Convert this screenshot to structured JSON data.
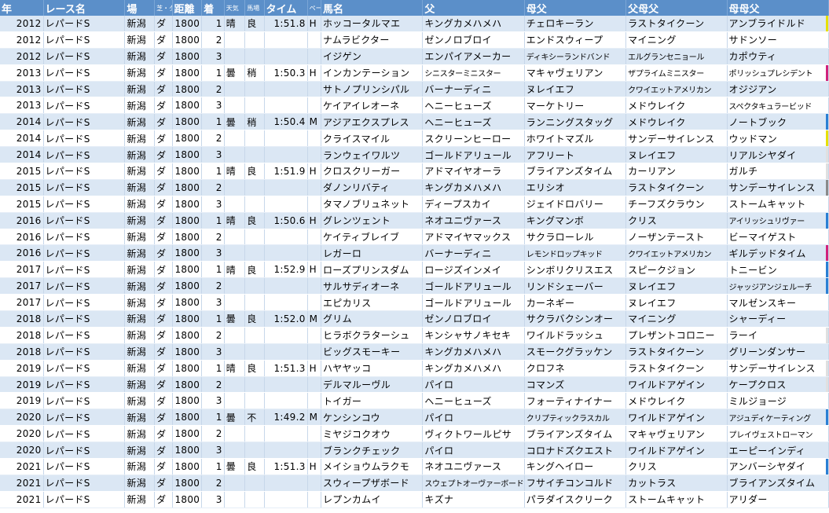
{
  "headers": [
    "年",
    "レース名",
    "場",
    "芝・ダ",
    "距離",
    "着",
    "天気",
    "馬場",
    "タイム",
    "ペース",
    "馬名",
    "父",
    "母父",
    "父母父",
    "母母父"
  ],
  "rows": [
    [
      "2012",
      "レパードS",
      "新潟",
      "ダ",
      "1800",
      "1",
      "晴",
      "良",
      "1:51.8",
      "H",
      "ホッコータルマエ",
      "キングカメハメハ",
      "チェロキーラン",
      "ラストタイクーン",
      "アンブライドルド"
    ],
    [
      "2012",
      "レパードS",
      "新潟",
      "ダ",
      "1800",
      "2",
      "",
      "",
      "",
      "",
      "ナムラビクター",
      "ゼンノロブロイ",
      "エンドスウィープ",
      "マイニング",
      "サドンソー"
    ],
    [
      "2012",
      "レパードS",
      "新潟",
      "ダ",
      "1800",
      "3",
      "",
      "",
      "",
      "",
      "イジゲン",
      "エンパイアメーカー",
      "ディキシーランドバンド",
      "エルグランセニョール",
      "カポウティ"
    ],
    [
      "2013",
      "レパードS",
      "新潟",
      "ダ",
      "1800",
      "1",
      "曇",
      "稍",
      "1:50.3",
      "H",
      "インカンテーション",
      "シニスターミニスター",
      "マキャヴェリアン",
      "ザプライムミニスター",
      "ポリッシュプレシデント"
    ],
    [
      "2013",
      "レパードS",
      "新潟",
      "ダ",
      "1800",
      "2",
      "",
      "",
      "",
      "",
      "サトノプリンシパル",
      "バーナーディニ",
      "ヌレイエフ",
      "クワイエットアメリカン",
      "オジジアン"
    ],
    [
      "2013",
      "レパードS",
      "新潟",
      "ダ",
      "1800",
      "3",
      "",
      "",
      "",
      "",
      "ケイアイレオーネ",
      "ヘニーヒューズ",
      "マーケトリー",
      "メドウレイク",
      "スペクタキュラービッド"
    ],
    [
      "2014",
      "レパードS",
      "新潟",
      "ダ",
      "1800",
      "1",
      "曇",
      "稍",
      "1:50.4",
      "M",
      "アジアエクスプレス",
      "ヘニーヒューズ",
      "ランニングスタッグ",
      "メドウレイク",
      "ノートブック"
    ],
    [
      "2014",
      "レパードS",
      "新潟",
      "ダ",
      "1800",
      "2",
      "",
      "",
      "",
      "",
      "クライスマイル",
      "スクリーンヒーロー",
      "ホワイトマズル",
      "サンデーサイレンス",
      "ウッドマン"
    ],
    [
      "2014",
      "レパードS",
      "新潟",
      "ダ",
      "1800",
      "3",
      "",
      "",
      "",
      "",
      "ランウェイワルツ",
      "ゴールドアリュール",
      "アフリート",
      "ヌレイエフ",
      "リアルシヤダイ"
    ],
    [
      "2015",
      "レパードS",
      "新潟",
      "ダ",
      "1800",
      "1",
      "晴",
      "良",
      "1:51.9",
      "H",
      "クロスクリーガー",
      "アドマイヤオーラ",
      "ブライアンズタイム",
      "カーリアン",
      "ガルチ"
    ],
    [
      "2015",
      "レパードS",
      "新潟",
      "ダ",
      "1800",
      "2",
      "",
      "",
      "",
      "",
      "ダノンリバティ",
      "キングカメハメハ",
      "エリシオ",
      "ラストタイクーン",
      "サンデーサイレンス"
    ],
    [
      "2015",
      "レパードS",
      "新潟",
      "ダ",
      "1800",
      "3",
      "",
      "",
      "",
      "",
      "タマノブリュネット",
      "ディープスカイ",
      "ジェイドロバリー",
      "チーフズクラウン",
      "ストームキャット"
    ],
    [
      "2016",
      "レパードS",
      "新潟",
      "ダ",
      "1800",
      "1",
      "晴",
      "良",
      "1:50.6",
      "H",
      "グレンツェント",
      "ネオユニヴァース",
      "キングマンボ",
      "クリス",
      "アイリッシュリヴァー"
    ],
    [
      "2016",
      "レパードS",
      "新潟",
      "ダ",
      "1800",
      "2",
      "",
      "",
      "",
      "",
      "ケイティブレイブ",
      "アドマイヤマックス",
      "サクラローレル",
      "ノーザンテースト",
      "ビーマイゲスト"
    ],
    [
      "2016",
      "レパードS",
      "新潟",
      "ダ",
      "1800",
      "3",
      "",
      "",
      "",
      "",
      "レガーロ",
      "バーナーディニ",
      "レモンドロップキッド",
      "クワイエットアメリカン",
      "ギルデッドタイム"
    ],
    [
      "2017",
      "レパードS",
      "新潟",
      "ダ",
      "1800",
      "1",
      "晴",
      "良",
      "1:52.9",
      "H",
      "ローズプリンスダム",
      "ロージズインメイ",
      "シンボリクリスエス",
      "スピークジョン",
      "トニービン"
    ],
    [
      "2017",
      "レパードS",
      "新潟",
      "ダ",
      "1800",
      "2",
      "",
      "",
      "",
      "",
      "サルサディオーネ",
      "ゴールドアリュール",
      "リンドシェーバー",
      "ヌレイエフ",
      "ジャッジアンジェルーチ"
    ],
    [
      "2017",
      "レパードS",
      "新潟",
      "ダ",
      "1800",
      "3",
      "",
      "",
      "",
      "",
      "エピカリス",
      "ゴールドアリュール",
      "カーネギー",
      "ヌレイエフ",
      "マルゼンスキー"
    ],
    [
      "2018",
      "レパードS",
      "新潟",
      "ダ",
      "1800",
      "1",
      "曇",
      "良",
      "1:52.0",
      "M",
      "グリム",
      "ゼンノロブロイ",
      "サクラバクシンオー",
      "マイニング",
      "シャーディー"
    ],
    [
      "2018",
      "レパードS",
      "新潟",
      "ダ",
      "1800",
      "2",
      "",
      "",
      "",
      "",
      "ヒラボクラターシュ",
      "キンシャサノキセキ",
      "ワイルドラッシュ",
      "プレザントコロニー",
      "ラーイ"
    ],
    [
      "2018",
      "レパードS",
      "新潟",
      "ダ",
      "1800",
      "3",
      "",
      "",
      "",
      "",
      "ビッグスモーキー",
      "キングカメハメハ",
      "スモークグラッケン",
      "ラストタイクーン",
      "グリーンダンサー"
    ],
    [
      "2019",
      "レパードS",
      "新潟",
      "ダ",
      "1800",
      "1",
      "晴",
      "良",
      "1:51.3",
      "H",
      "ハヤヤッコ",
      "キングカメハメハ",
      "クロフネ",
      "ラストタイクーン",
      "サンデーサイレンス"
    ],
    [
      "2019",
      "レパードS",
      "新潟",
      "ダ",
      "1800",
      "2",
      "",
      "",
      "",
      "",
      "デルマルーヴル",
      "パイロ",
      "コマンズ",
      "ワイルドアゲイン",
      "ケープクロス"
    ],
    [
      "2019",
      "レパードS",
      "新潟",
      "ダ",
      "1800",
      "3",
      "",
      "",
      "",
      "",
      "トイガー",
      "ヘニーヒューズ",
      "フォーティナイナー",
      "メドウレイク",
      "ミルジョージ"
    ],
    [
      "2020",
      "レパードS",
      "新潟",
      "ダ",
      "1800",
      "1",
      "曇",
      "不",
      "1:49.2",
      "M",
      "ケンシンコウ",
      "パイロ",
      "クリプティックラスカル",
      "ワイルドアゲイン",
      "アジュディケーティング"
    ],
    [
      "2020",
      "レパードS",
      "新潟",
      "ダ",
      "1800",
      "2",
      "",
      "",
      "",
      "",
      "ミヤジコクオウ",
      "ヴィクトワールピサ",
      "ブライアンズタイム",
      "マキャヴェリアン",
      "プレイヴェストローマン"
    ],
    [
      "2020",
      "レパードS",
      "新潟",
      "ダ",
      "1800",
      "3",
      "",
      "",
      "",
      "",
      "ブランクチェック",
      "パイロ",
      "コロナドズクエスト",
      "ワイルドアゲイン",
      "エーピーインディ"
    ],
    [
      "2021",
      "レパードS",
      "新潟",
      "ダ",
      "1800",
      "1",
      "曇",
      "良",
      "1:51.3",
      "H",
      "メイショウムラクモ",
      "ネオユニヴァース",
      "キングヘイロー",
      "クリス",
      "アンバーシヤダイ"
    ],
    [
      "2021",
      "レパードS",
      "新潟",
      "ダ",
      "1800",
      "2",
      "",
      "",
      "",
      "",
      "スウィープザボード",
      "スウェプトオーヴァーボード",
      "フサイチコンコルド",
      "カットラス",
      "ブライアンズタイム"
    ],
    [
      "2021",
      "レパードS",
      "新潟",
      "ダ",
      "1800",
      "3",
      "",
      "",
      "",
      "",
      "レプンカムイ",
      "キズナ",
      "パラダイスクリーク",
      "ストームキャット",
      "アリダー"
    ]
  ],
  "row_marks": {
    "0": "#e8e000",
    "3": "#d0217c",
    "6": "#2a7fd4",
    "7": "#e8e000",
    "8": "#e0e0e0",
    "9": "#e0e0e0",
    "10": "#8a8a8a",
    "12": "#2a7fd4",
    "14": "#d0217c",
    "15": "#2a7fd4",
    "16": "#2a7fd4",
    "19": "#e0e0e0",
    "21": "#e0e0e0",
    "22": "#e0e0e0",
    "24": "#2a7fd4",
    "27": "#2a7fd4"
  }
}
